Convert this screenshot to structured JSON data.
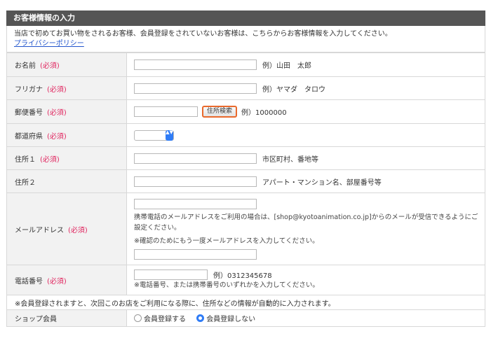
{
  "form": {
    "title": "お客様情報の入力",
    "intro_text": "当店で初めてお買い物をされるお客様、会員登録をされていないお客様は、こちらからお客様情報を入力してください。",
    "privacy_link": "プライバシーポリシー",
    "required_label": "(必須)",
    "rows": {
      "name": {
        "label": "お名前",
        "example": "例）山田　太郎"
      },
      "furigana": {
        "label": "フリガナ",
        "example": "例）ヤマダ　タロウ"
      },
      "postal": {
        "label": "郵便番号",
        "button": "住所検索",
        "example": "例）1000000"
      },
      "prefecture": {
        "label": "都道府県",
        "arrows": "▲▼"
      },
      "address1": {
        "label": "住所１",
        "example": "市区町村、番地等"
      },
      "address2": {
        "label": "住所２",
        "example": "アパート・マンション名、部屋番号等"
      },
      "email": {
        "label": "メールアドレス",
        "note": "携帯電話のメールアドレスをご利用の場合は、[shop@kyotoanimation.co.jp]からのメールが受信できるようにご設定ください。",
        "confirm_note": "※確認のためにもう一度メールアドレスを入力してください。"
      },
      "phone": {
        "label": "電話番号",
        "example": "例）0312345678",
        "note": "※電話番号、または携帯番号のいずれかを入力してください。"
      }
    },
    "autofill_notice": "※会員登録されますと、次回このお店をご利用になる際に、住所などの情報が自動的に入力されます。",
    "membership": {
      "label": "ショップ会員",
      "options": [
        "会員登録する",
        "会員登録しない"
      ],
      "selected": "会員登録しない"
    }
  },
  "colors": {
    "header_bg": "#555555",
    "required": "#e0245e",
    "accent": "#2f7cf6",
    "button_border": "#e9692c"
  }
}
